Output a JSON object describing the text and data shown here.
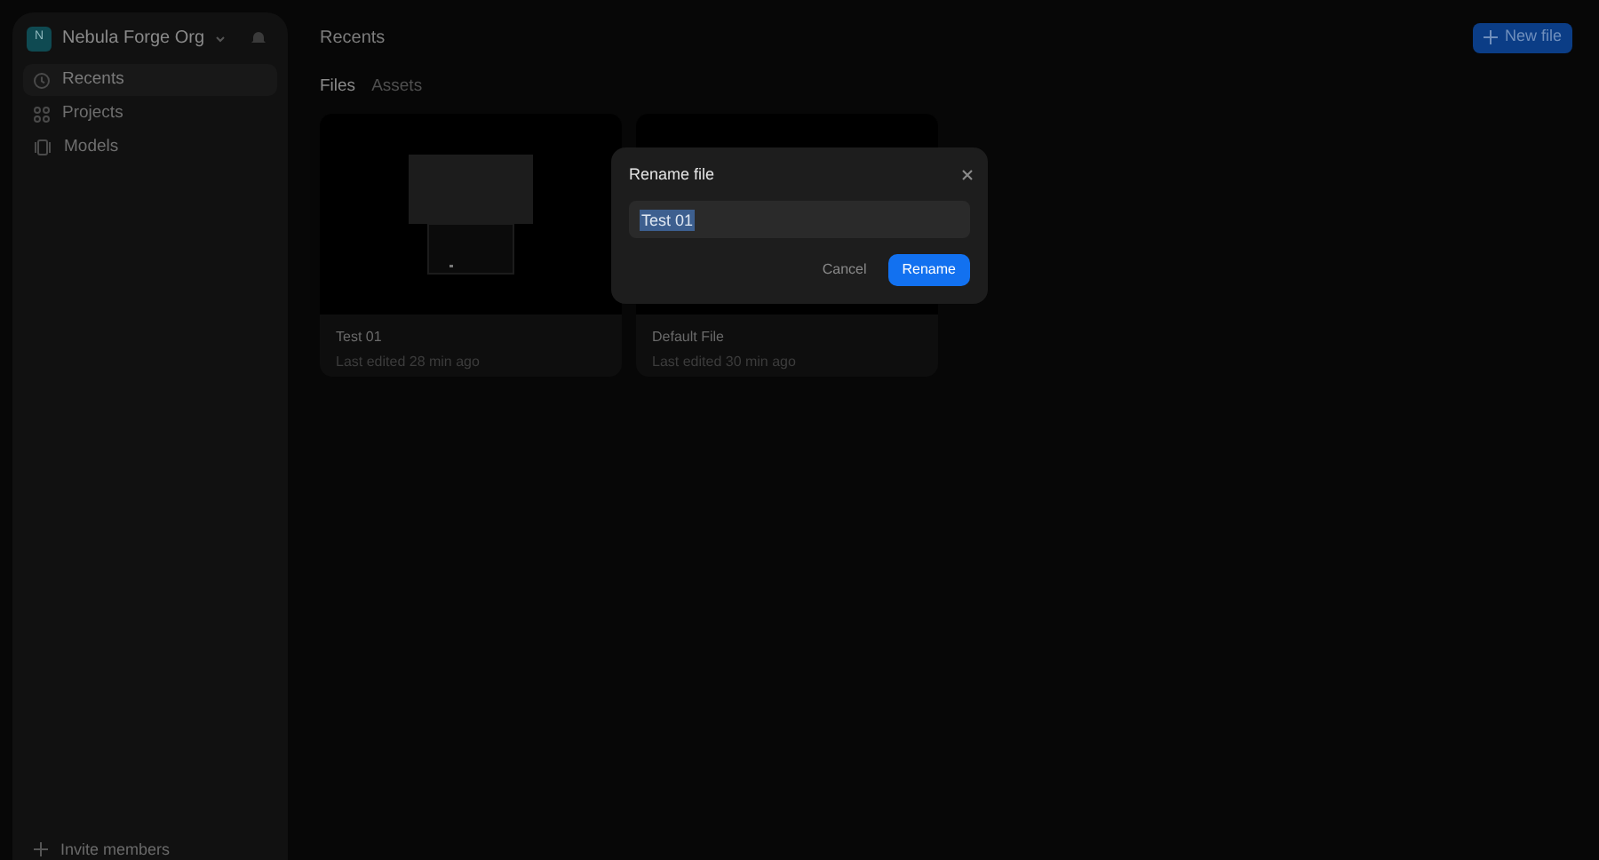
{
  "sidebar": {
    "org": {
      "initial": "N",
      "name": "Nebula Forge Org"
    },
    "items": [
      {
        "label": "Recents",
        "kind": "clock",
        "selected": true
      },
      {
        "label": "Projects",
        "kind": "grid",
        "selected": false
      },
      {
        "label": "Models",
        "kind": "cube",
        "selected": false
      }
    ],
    "footer": "Invite members"
  },
  "header": {
    "title": "Recents",
    "button": "New file"
  },
  "tabs": [
    {
      "label": "Files",
      "selected": true
    },
    {
      "label": "Assets",
      "selected": false
    }
  ],
  "files": [
    {
      "name": "Test 01",
      "edited": "Last edited 28 min ago"
    },
    {
      "name": "Default File",
      "edited": "Last edited 30 min ago"
    }
  ],
  "dialog": {
    "title": "Rename file",
    "value": "Test 01",
    "cancel": "Cancel",
    "confirm": "Rename"
  }
}
